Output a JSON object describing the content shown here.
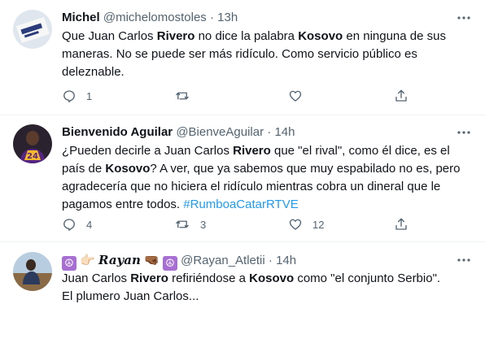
{
  "tweets": [
    {
      "display_name": "Michel",
      "handle": "@michelomostoles",
      "sep": "·",
      "time": "13h",
      "text": [
        {
          "t": "Que Juan Carlos "
        },
        {
          "t": "Rivero",
          "bold": true
        },
        {
          "t": " no dice la palabra "
        },
        {
          "t": "Kosovo",
          "bold": true
        },
        {
          "t": " en ninguna de sus maneras. No se puede ser más ridículo. Como servicio público es deleznable."
        }
      ],
      "replies": "1",
      "retweets": "",
      "likes": ""
    },
    {
      "display_name": "Bienvenido Aguilar",
      "handle": "@BienveAguilar",
      "sep": "·",
      "time": "14h",
      "text": [
        {
          "t": "¿Pueden decirle a Juan Carlos "
        },
        {
          "t": "Rivero",
          "bold": true
        },
        {
          "t": " que \"el rival\", como él dice, es el país de "
        },
        {
          "t": "Kosovo",
          "bold": true
        },
        {
          "t": "? A ver, que ya sabemos que muy espabilado no es, pero agradecería que no hiciera el ridículo mientras cobra un dineral que le pagamos entre todos. "
        },
        {
          "t": "#RumboaCatarRTVE",
          "hashtag": true
        }
      ],
      "replies": "4",
      "retweets": "3",
      "likes": "12"
    },
    {
      "display_name": "Rayan",
      "handle": "@Rayan_Atletii",
      "sep": "·",
      "time": "14h",
      "text": [
        {
          "t": "Juan Carlos "
        },
        {
          "t": "Rivero",
          "bold": true
        },
        {
          "t": " refiriéndose a "
        },
        {
          "t": "Kosovo",
          "bold": true
        },
        {
          "t": " como \"el conjunto Serbio\".\nEl plumero Juan Carlos..."
        }
      ]
    }
  ],
  "icons": [
    "more-icon",
    "reply-icon",
    "retweet-icon",
    "like-icon",
    "share-icon",
    "peace-symbol-icon",
    "hand-icon"
  ],
  "colors": {
    "text": "#0f1419",
    "muted": "#536471",
    "link": "#1d9bf0",
    "divider": "#eff3f4"
  }
}
